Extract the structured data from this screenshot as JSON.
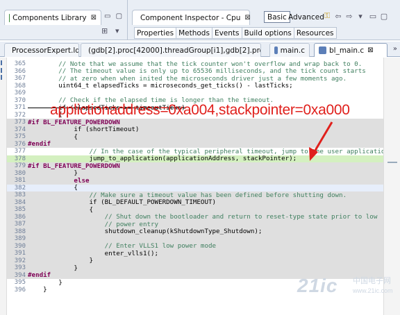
{
  "left_panel": {
    "tab_label": "Components Library",
    "tab_close": "⊠"
  },
  "right_panel": {
    "tab_label": "Component Inspector - Cpu",
    "tab_close": "⊠",
    "mode_basic": "Basic",
    "mode_advanced": "Advanced",
    "subtabs": [
      "Properties",
      "Methods",
      "Events",
      "Build options",
      "Resources"
    ]
  },
  "editor_tabs": [
    {
      "label": "ProcessorExpert.ld",
      "active": false
    },
    {
      "label": "(gdb[2].proc[42000].threadGroup[i1],gdb[2].proc...",
      "active": false
    },
    {
      "label": "main.c",
      "active": false
    },
    {
      "label": "bl_main.c",
      "active": true,
      "close": "⊠"
    }
  ],
  "tab_overflow": "»",
  "code_lines": [
    {
      "n": "365",
      "text": "        // Note that we assume that the tick counter won't overflow and wrap back to 0.",
      "style": "comment",
      "bg": ""
    },
    {
      "n": "366",
      "text": "        // The timeout value is only up to 65536 milliseconds, and the tick count starts",
      "style": "comment",
      "bg": ""
    },
    {
      "n": "367",
      "text": "        // at zero when when inited the microseconds driver just a few moments ago.",
      "style": "comment",
      "bg": ""
    },
    {
      "n": "368",
      "text": "        uint64_t elapsedTicks = microseconds_get_ticks() - lastTicks;",
      "style": "",
      "bg": ""
    },
    {
      "n": "369",
      "text": "",
      "style": "",
      "bg": ""
    },
    {
      "n": "370",
      "text": "        // Check if the elapsed time is longer than the timeout.",
      "style": "comment",
      "bg": ""
    },
    {
      "n": "371",
      "text": "        if (elapsedTicks >= timeoutTicks)",
      "style": "strike",
      "bg": ""
    },
    {
      "n": "372",
      "text": "        {",
      "style": "",
      "bg": ""
    },
    {
      "n": "373",
      "text": "#if BL_FEATURE_POWERDOWN",
      "style": "pre",
      "bg": "gray"
    },
    {
      "n": "374",
      "text": "            if (shortTimeout)",
      "style": "",
      "bg": "gray"
    },
    {
      "n": "375",
      "text": "            {",
      "style": "",
      "bg": "gray"
    },
    {
      "n": "376",
      "text": "#endif",
      "style": "pre",
      "bg": "gray"
    },
    {
      "n": "377",
      "text": "                // In the case of the typical peripheral timeout, jump to the user applicatio",
      "style": "comment",
      "bg": ""
    },
    {
      "n": "378",
      "text": "                jump_to_application(applicationAddress, stackPointer);",
      "style": "",
      "bg": "green"
    },
    {
      "n": "379",
      "text": "#if BL_FEATURE_POWERDOWN",
      "style": "pre",
      "bg": "gray"
    },
    {
      "n": "380",
      "text": "            }",
      "style": "",
      "bg": "gray"
    },
    {
      "n": "381",
      "text": "            else",
      "style": "keyword",
      "bg": "gray"
    },
    {
      "n": "382",
      "text": "            {",
      "style": "",
      "bg": "blue"
    },
    {
      "n": "383",
      "text": "                // Make sure a timeout value has been defined before shutting down.",
      "style": "comment",
      "bg": "gray"
    },
    {
      "n": "384",
      "text": "                if (BL_DEFAULT_POWERDOWN_TIMEOUT)",
      "style": "",
      "bg": "gray"
    },
    {
      "n": "385",
      "text": "                {",
      "style": "",
      "bg": "gray"
    },
    {
      "n": "386",
      "text": "                    // Shut down the bootloader and return to reset-type state prior to low",
      "style": "comment",
      "bg": "gray"
    },
    {
      "n": "387",
      "text": "                    // power entry",
      "style": "comment",
      "bg": "gray"
    },
    {
      "n": "388",
      "text": "                    shutdown_cleanup(kShutdownType_Shutdown);",
      "style": "",
      "bg": "gray"
    },
    {
      "n": "389",
      "text": "",
      "style": "",
      "bg": "gray"
    },
    {
      "n": "390",
      "text": "                    // Enter VLLS1 low power mode",
      "style": "comment",
      "bg": "gray"
    },
    {
      "n": "391",
      "text": "                    enter_vlls1();",
      "style": "",
      "bg": "gray"
    },
    {
      "n": "392",
      "text": "                }",
      "style": "",
      "bg": "gray"
    },
    {
      "n": "393",
      "text": "            }",
      "style": "",
      "bg": "gray"
    },
    {
      "n": "394",
      "text": "#endif",
      "style": "pre",
      "bg": "gray"
    },
    {
      "n": "395",
      "text": "        }",
      "style": "",
      "bg": ""
    },
    {
      "n": "396",
      "text": "    }",
      "style": "",
      "bg": ""
    }
  ],
  "annotation": {
    "text": "applictionaddress=0xa004,stackpointer=0xa000",
    "color": "#e0201c"
  },
  "watermark": {
    "logo": "21ic",
    "cn": "中国电子网",
    "url": "www.21ic.com"
  },
  "colors": {
    "inactive_code_bg": "#dfdfdf",
    "current_line_bg": "#d4f0c0",
    "comment": "#3f7f5f",
    "keyword": "#7f0055"
  }
}
